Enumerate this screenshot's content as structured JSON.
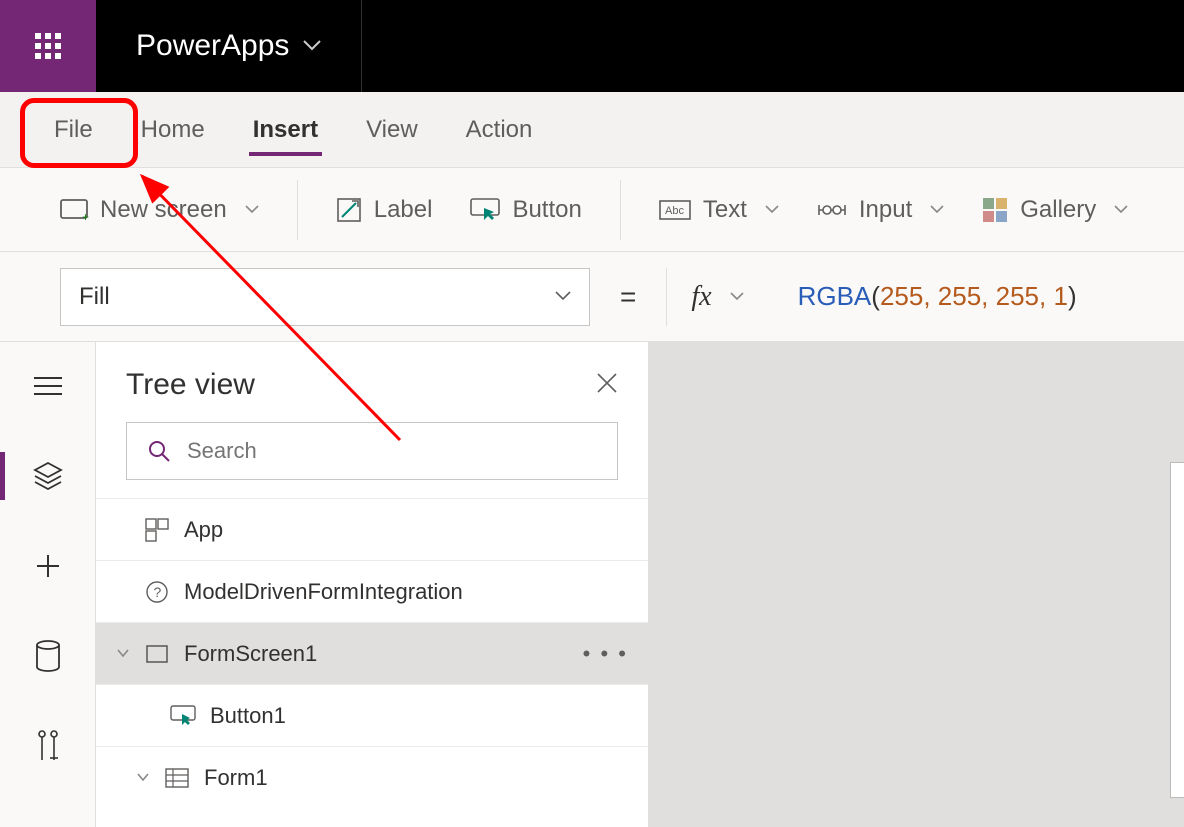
{
  "topbar": {
    "brand": "PowerApps"
  },
  "menu": {
    "file": "File",
    "home": "Home",
    "insert": "Insert",
    "view": "View",
    "action": "Action"
  },
  "ribbon": {
    "new_screen": "New screen",
    "label": "Label",
    "button": "Button",
    "text": "Text",
    "input": "Input",
    "gallery": "Gallery"
  },
  "formula": {
    "property": "Fill",
    "equals": "=",
    "fx": "fx",
    "fn": "RGBA",
    "open": "(",
    "a1": "255",
    "c": ", ",
    "a2": "255",
    "a3": "255",
    "a4": "1",
    "close": ")"
  },
  "tree": {
    "title": "Tree view",
    "search_placeholder": "Search",
    "items": {
      "app": "App",
      "mdfi": "ModelDrivenFormIntegration",
      "formscreen1": "FormScreen1",
      "button1": "Button1",
      "form1": "Form1"
    },
    "more": "• • •"
  }
}
